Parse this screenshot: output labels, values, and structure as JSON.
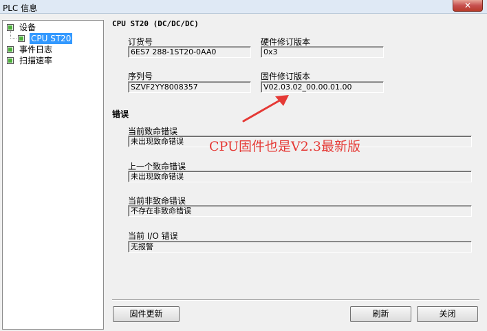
{
  "window": {
    "title": "PLC 信息",
    "close_label": "✕"
  },
  "tree": [
    {
      "label": "设备"
    },
    {
      "label": "CPU ST20"
    },
    {
      "label": "事件日志"
    },
    {
      "label": "扫描速率"
    }
  ],
  "device": {
    "heading": "CPU ST20 (DC/DC/DC)",
    "order_label": "订货号",
    "order_value": "6ES7 288-1ST20-0AA0",
    "hw_label": "硬件修订版本",
    "hw_value": "0x3",
    "serial_label": "序列号",
    "serial_value": "SZVF2YY8008357",
    "fw_label": "固件修订版本",
    "fw_value": "V02.03.02_00.00.01.00"
  },
  "errors": {
    "title": "错误",
    "current_fatal_label": "当前致命错误",
    "current_fatal_value": "未出现致命错误",
    "last_fatal_label": "上一个致命错误",
    "last_fatal_value": "未出现致命错误",
    "current_nonfatal_label": "当前非致命错误",
    "current_nonfatal_value": "不存在非致命错误",
    "current_io_label": "当前 I/O 错误",
    "current_io_value": "无报警"
  },
  "annotation": {
    "text": "CPU固件也是V2.3最新版",
    "color": "#e53935"
  },
  "buttons": {
    "firmware_update": "固件更新",
    "refresh": "刷新",
    "close": "关闭"
  }
}
